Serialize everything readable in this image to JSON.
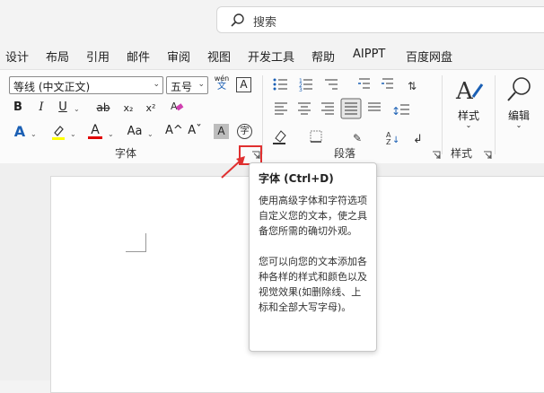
{
  "search": {
    "placeholder": "搜索"
  },
  "menu": [
    {
      "label": "设计"
    },
    {
      "label": "布局"
    },
    {
      "label": "引用"
    },
    {
      "label": "邮件"
    },
    {
      "label": "审阅"
    },
    {
      "label": "视图"
    },
    {
      "label": "开发工具"
    },
    {
      "label": "帮助"
    },
    {
      "label": "AIPPT"
    },
    {
      "label": "百度网盘"
    }
  ],
  "font": {
    "name": "等线 (中文正文)",
    "size": "五号",
    "phonetic_top": "wén",
    "phonetic_bottom": "文",
    "border_char": "A",
    "bold": "B",
    "italic": "I",
    "underline": "U",
    "strike": "ab",
    "sub": "x₂",
    "sup": "x²",
    "text_effects": "A",
    "font_color": "A",
    "case": "Aa",
    "grow": "A^",
    "shrink": "Aˇ",
    "shade": "A",
    "circle": "字",
    "group_label": "字体"
  },
  "paragraph": {
    "group_label": "段落"
  },
  "styles": {
    "button_label": "样式",
    "group_label": "样式"
  },
  "editing": {
    "button_label": "编辑"
  },
  "tooltip": {
    "title": "字体 (Ctrl+D)",
    "line1": "使用高级字体和字符选项自定义您的文本，使之具备您所需的确切外观。",
    "line2": "您可以向您的文本添加各种各样的样式和颜色以及视觉效果(如删除线、上标和全部大写字母)。"
  },
  "colors": {
    "accent": "#1a5fb4",
    "highlight": "#ffff00",
    "font_red": "#e00000"
  }
}
